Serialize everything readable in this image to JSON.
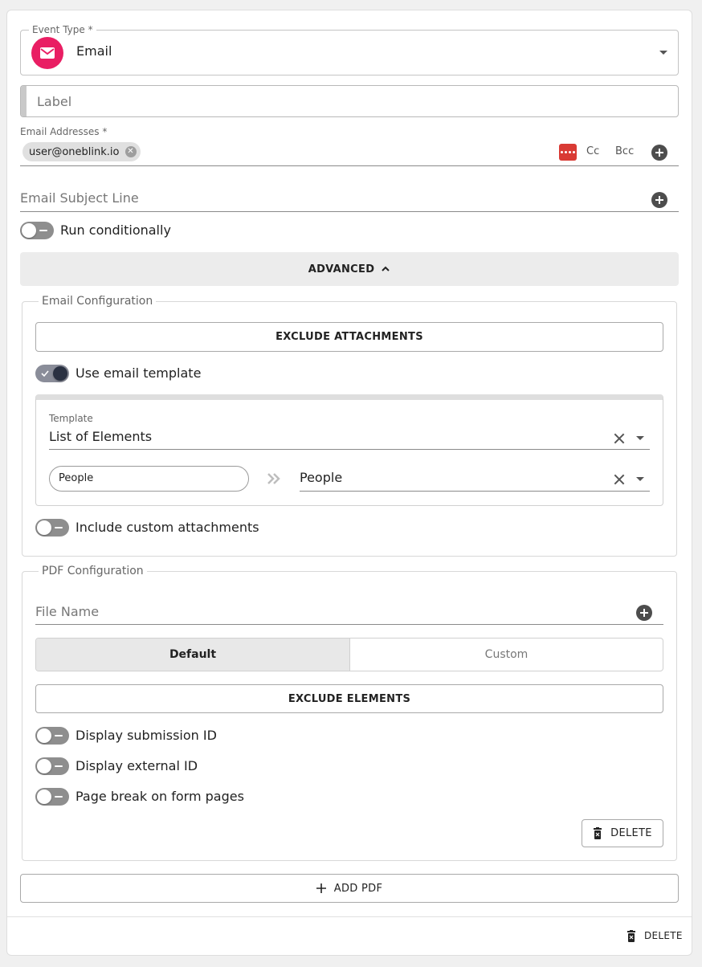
{
  "event_type": {
    "legend": "Event Type *",
    "value": "Email",
    "icon": "email-icon",
    "icon_color": "#e91e63"
  },
  "label_field": {
    "placeholder": "Label"
  },
  "email_addresses": {
    "legend": "Email Addresses *",
    "chips": [
      "user@oneblink.io"
    ],
    "cc_label": "Cc",
    "bcc_label": "Bcc",
    "password_icon_color": "#d93a34"
  },
  "subject_field": {
    "placeholder": "Email Subject Line"
  },
  "run_conditionally": {
    "label": "Run conditionally",
    "on": false
  },
  "advanced": {
    "label": "ADVANCED"
  },
  "email_config": {
    "legend": "Email Configuration",
    "exclude_attachments_label": "EXCLUDE ATTACHMENTS",
    "use_template": {
      "label": "Use email template",
      "on": true
    },
    "template": {
      "legend": "Template",
      "value": "List of Elements",
      "mapping": {
        "left_value": "People",
        "right_value": "People"
      }
    },
    "custom_attachments": {
      "label": "Include custom attachments",
      "on": false
    }
  },
  "pdf_config": {
    "legend": "PDF Configuration",
    "file_name_placeholder": "File Name",
    "tabs": [
      "Default",
      "Custom"
    ],
    "selected_tab": "Default",
    "exclude_elements_label": "EXCLUDE ELEMENTS",
    "toggles": [
      {
        "label": "Display submission ID",
        "on": false
      },
      {
        "label": "Display external ID",
        "on": false
      },
      {
        "label": "Page break on form pages",
        "on": false
      }
    ],
    "delete_label": "DELETE"
  },
  "add_pdf_label": "ADD PDF",
  "footer": {
    "delete_label": "DELETE"
  }
}
